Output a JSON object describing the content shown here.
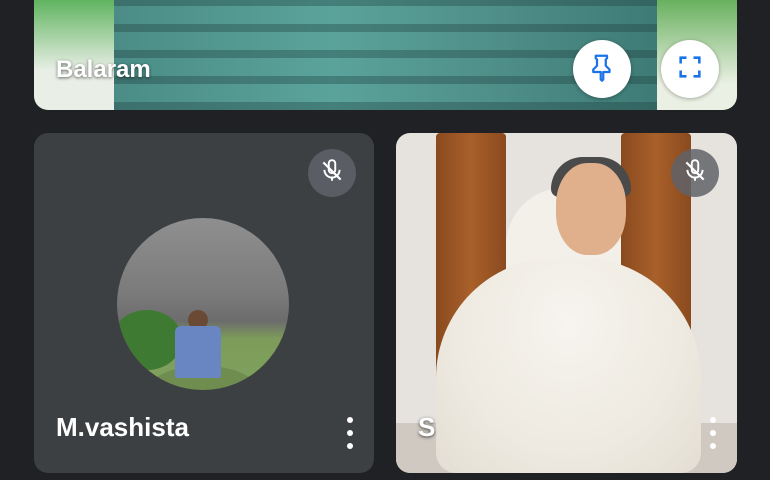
{
  "participants": {
    "top": {
      "name": "Balaram",
      "pin_icon": "pin-icon",
      "fullscreen_icon": "fullscreen-icon"
    },
    "left": {
      "name": "M.vashista",
      "mic_status_icon": "mic-off-icon",
      "more_icon": "more-vert-icon"
    },
    "right": {
      "name": "S",
      "mic_status_icon": "mic-off-icon",
      "more_icon": "more-vert-icon"
    }
  },
  "colors": {
    "background": "#202124",
    "tile": "#3c4043",
    "accent": "#1a73e8"
  }
}
